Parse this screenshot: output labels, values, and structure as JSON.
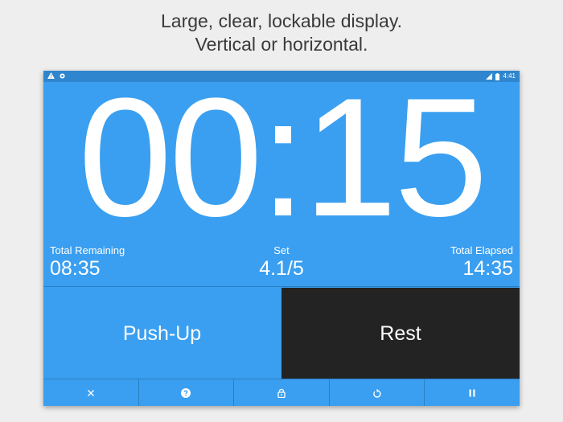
{
  "caption": {
    "line1": "Large, clear, lockable display.",
    "line2": "Vertical or horizontal."
  },
  "statusbar": {
    "time": "4:41",
    "icons": [
      "warning-icon",
      "notification-icon",
      "signal-icon",
      "battery-icon"
    ]
  },
  "timer": {
    "display": "00:15"
  },
  "stats": {
    "remaining_label": "Total Remaining",
    "remaining_value": "08:35",
    "set_label": "Set",
    "set_value": "4.1/5",
    "elapsed_label": "Total Elapsed",
    "elapsed_value": "14:35"
  },
  "buttons": {
    "exercise_label": "Push-Up",
    "rest_label": "Rest"
  },
  "toolbar": {
    "icons": [
      "close-icon",
      "help-icon",
      "lock-icon",
      "restart-icon",
      "pause-icon"
    ]
  },
  "colors": {
    "primary": "#3a9ff0",
    "statusbar": "#2f86cf",
    "rest_background": "#232323",
    "background": "#eeeeee"
  }
}
